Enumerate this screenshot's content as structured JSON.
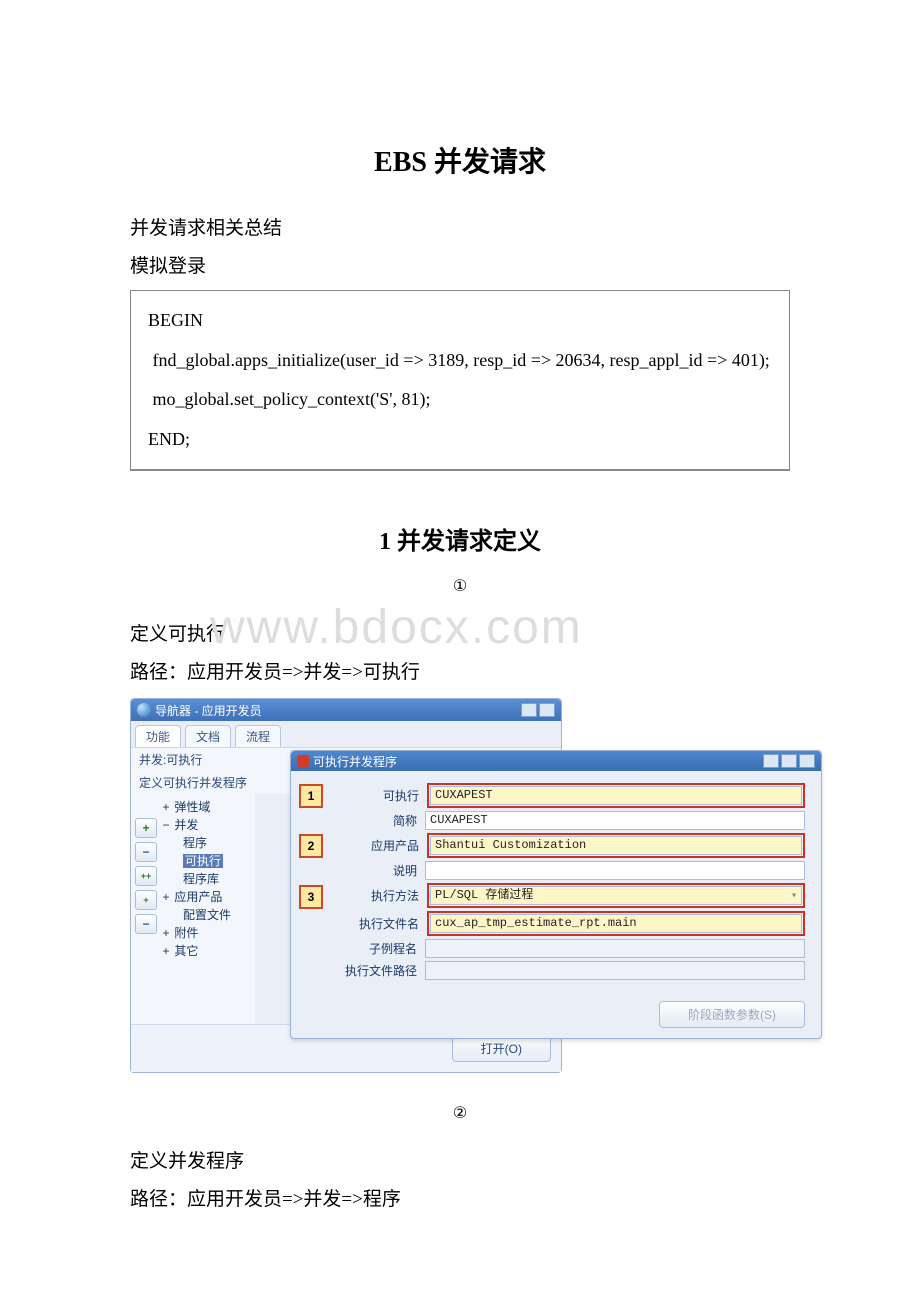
{
  "title": "EBS 并发请求",
  "intro1": "并发请求相关总结",
  "intro2": "模拟登录",
  "code": {
    "l1": "  BEGIN",
    "l2": "   fnd_global.apps_initialize(user_id => 3189, resp_id => 20634, resp_appl_id => 401);",
    "l3": "   mo_global.set_policy_context('S', 81);",
    "l4": "  END;"
  },
  "section1_title": "1 并发请求定义",
  "circ1": "①",
  "sec1_line1": "定义可执行",
  "sec1_line2": "路径：应用开发员=>并发=>可执行",
  "circ2": "②",
  "sec2_line1": "定义并发程序",
  "sec2_line2": "路径：应用开发员=>并发=>程序",
  "watermark": "www.bdocx.com",
  "nav": {
    "title": "导航器 - 应用开发员",
    "tabs": {
      "t0": "功能",
      "t1": "文档",
      "t2": "流程"
    },
    "breadcrumb": "并发:可执行",
    "heading": "定义可执行并发程序",
    "tree": {
      "n0": "弹性域",
      "n1": "并发",
      "n1a": "程序",
      "n1b": "可执行",
      "n1c": "程序库",
      "n2": "应用产品",
      "n2a": "配置文件",
      "n3": "附件",
      "n4": "其它"
    },
    "open_btn": "打开(O)"
  },
  "exec": {
    "title": "可执行并发程序",
    "labels": {
      "l1": "可执行",
      "l2": "简称",
      "l3": "应用产品",
      "l4": "说明",
      "l5": "执行方法",
      "l6": "执行文件名",
      "l7": "子例程名",
      "l8": "执行文件路径"
    },
    "values": {
      "v1": "CUXAPEST",
      "v2": "CUXAPEST",
      "v3": "Shantui Customization",
      "v4": "",
      "v5": "PL/SQL 存储过程",
      "v6": "cux_ap_tmp_estimate_rpt.main",
      "v7": "",
      "v8": ""
    },
    "footer_btn": "阶段函数参数(S)"
  }
}
